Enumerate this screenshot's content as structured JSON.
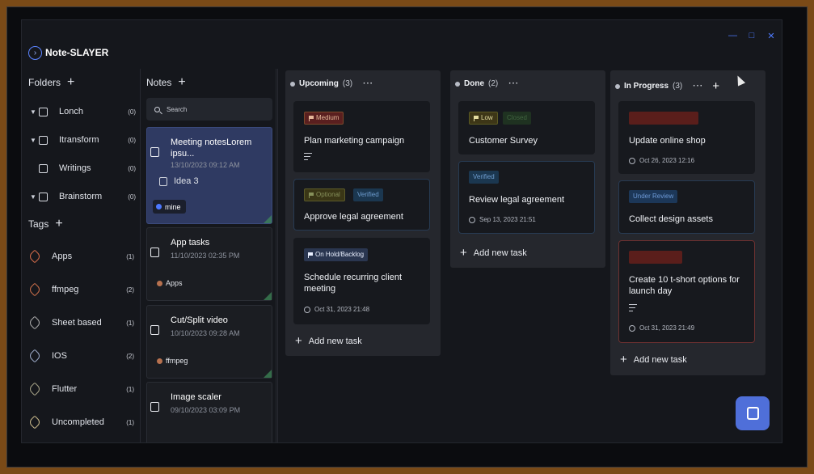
{
  "app": {
    "title": "Note-SLAYER"
  },
  "folders": {
    "label": "Folders",
    "items": [
      {
        "name": "Lonch",
        "count": "(0)",
        "caret": true
      },
      {
        "name": "Itransform",
        "count": "(0)",
        "caret": true
      },
      {
        "name": "Writings",
        "count": "(0)",
        "caret": false
      },
      {
        "name": "Brainstorm",
        "count": "(0)",
        "caret": true
      }
    ]
  },
  "tags": {
    "label": "Tags",
    "items": [
      {
        "name": "Apps",
        "count": "(1)",
        "color": "#d36b4a"
      },
      {
        "name": "ffmpeg",
        "count": "(2)",
        "color": "#c96e4a"
      },
      {
        "name": "Sheet based",
        "count": "(1)",
        "color": "#a9a9a9"
      },
      {
        "name": "IOS",
        "count": "(2)",
        "color": "#9aa7c4"
      },
      {
        "name": "Flutter",
        "count": "(1)",
        "color": "#a5a287"
      },
      {
        "name": "Uncompleted",
        "count": "(1)",
        "color": "#c9b98b"
      }
    ]
  },
  "notes": {
    "label": "Notes",
    "search_placeholder": "Search",
    "items": [
      {
        "title": "Meeting notesLorem ipsu...",
        "date": "13/10/2023 09:12 AM",
        "subnote": "Idea 3",
        "tag": "mine"
      },
      {
        "title": "App tasks",
        "date": "11/10/2023 02:35 PM",
        "tag": "Apps"
      },
      {
        "title": "Cut/Split video",
        "date": "10/10/2023 09:28 AM",
        "tag": "ffmpeg"
      },
      {
        "title": "Image scaler",
        "date": "09/10/2023 03:09 PM"
      }
    ]
  },
  "board": {
    "add_task_label": "Add new task",
    "menu_glyph": "···",
    "columns": [
      {
        "name": "Upcoming",
        "count": "(3)",
        "tasks": [
          {
            "badges": [
              "Medium"
            ],
            "title": "Plan marketing campaign"
          },
          {
            "badges": [
              "Optional",
              "Verified"
            ],
            "title": "Approve legal agreement"
          },
          {
            "badges": [
              "On Hold/Backlog"
            ],
            "title": "Schedule recurring client meeting",
            "date": "Oct 31, 2023 21:48"
          }
        ]
      },
      {
        "name": "Done",
        "count": "(2)",
        "tasks": [
          {
            "badges": [
              "Low",
              "Closed"
            ],
            "title": "Customer Survey"
          },
          {
            "badges": [
              "Verified"
            ],
            "title": "Review legal agreement",
            "date": "Sep 13, 2023 21:51"
          }
        ]
      },
      {
        "name": "In Progress",
        "count": "(3)",
        "tasks": [
          {
            "title": "Update online shop",
            "date": "Oct 26, 2023 12:16"
          },
          {
            "badges": [
              "Under Review"
            ],
            "title": "Collect design assets"
          },
          {
            "title": "Create 10 t-short options for launch day",
            "date": "Oct 31, 2023 21:49"
          }
        ]
      }
    ]
  }
}
